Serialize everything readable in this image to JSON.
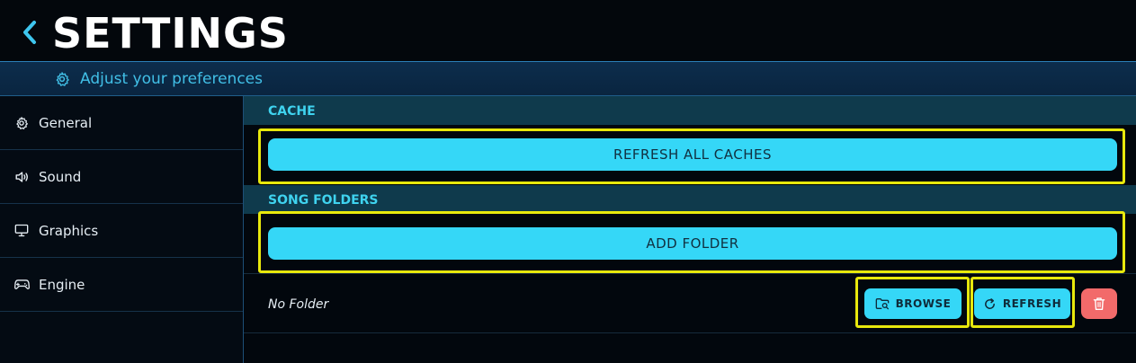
{
  "header": {
    "title": "SETTINGS",
    "back_icon": "chevron-left-icon"
  },
  "subheader": {
    "icon": "gear-icon",
    "text": "Adjust your preferences"
  },
  "sidebar": {
    "items": [
      {
        "label": "General",
        "icon": "gear-icon"
      },
      {
        "label": "Sound",
        "icon": "speaker-icon"
      },
      {
        "label": "Graphics",
        "icon": "monitor-icon"
      },
      {
        "label": "Engine",
        "icon": "gamepad-icon"
      }
    ]
  },
  "main": {
    "cache": {
      "heading": "CACHE",
      "refresh_all_label": "REFRESH ALL CACHES"
    },
    "song_folders": {
      "heading": "SONG FOLDERS",
      "add_folder_label": "ADD FOLDER",
      "folder_row": {
        "path": "No Folder",
        "browse_label": "BROWSE",
        "refresh_label": "REFRESH",
        "delete_icon": "trash-icon"
      }
    }
  },
  "colors": {
    "accent": "#35d7f7",
    "highlight": "#e8e80c",
    "danger": "#f26a6a",
    "section_bg": "#0f3a4c",
    "sidebar_border": "#1d4f78"
  }
}
